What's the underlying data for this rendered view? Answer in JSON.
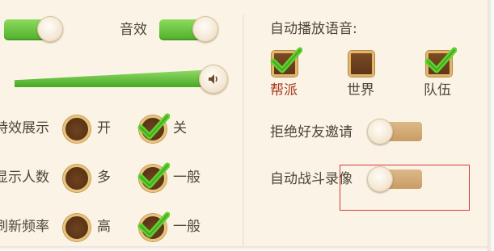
{
  "left": {
    "sound_effects_label": "音效",
    "settings": [
      {
        "label": "特效展示",
        "option_a": "开",
        "option_b": "关"
      },
      {
        "label": "显示人数",
        "option_a": "多",
        "option_b": "一般"
      },
      {
        "label": "刷新频率",
        "option_a": "高",
        "option_b": "一般"
      }
    ]
  },
  "right": {
    "auto_play_voice_label": "自动播放语音:",
    "channels": [
      {
        "label": "帮派",
        "checked": true
      },
      {
        "label": "世界",
        "checked": false
      },
      {
        "label": "队伍",
        "checked": true
      }
    ],
    "reject_friend_invite_label": "拒绝好友邀请",
    "auto_battle_record_label": "自动战斗录像"
  },
  "colors": {
    "toggle_on": "#5dbb35",
    "toggle_off": "#d2a672",
    "highlight": "#d23b3b"
  }
}
